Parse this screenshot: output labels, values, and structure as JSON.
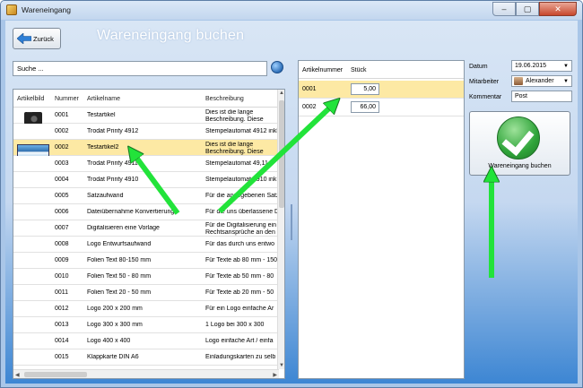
{
  "window": {
    "title": "Wareneingang",
    "controls": {
      "minimize": "–",
      "maximize": "▢",
      "close": "✕"
    }
  },
  "header": {
    "back_label": "Zurück",
    "page_title": "Wareneingang buchen"
  },
  "search": {
    "value": "Suche ..."
  },
  "articles_table": {
    "columns": [
      "Artikelbild",
      "Nummer",
      "Artikelname",
      "Beschreibung"
    ],
    "rows": [
      {
        "nummer": "0001",
        "name": "Testartikel",
        "desc": "Dies ist die lange Beschreibung. Diese können Sie formatieren",
        "image": "camera"
      },
      {
        "nummer": "0002",
        "name": "Trodat Printy 4912",
        "desc": "Stempelautomat 4912 inkl."
      },
      {
        "nummer": "0002",
        "name": "Testartikel2",
        "desc": "Dies ist die lange Beschreibung. Diese können Sie formatieren",
        "image": "landscape",
        "selected": true
      },
      {
        "nummer": "0003",
        "name": "Trodat Printy 4911",
        "desc": "Stempelautomat 49,11"
      },
      {
        "nummer": "0004",
        "name": "Trodat Printy 4910",
        "desc": "Stempelautomat 4910 ink"
      },
      {
        "nummer": "0005",
        "name": "Satzaufwand",
        "desc": "Für die angegebenen Satz"
      },
      {
        "nummer": "0006",
        "name": "Dateiübernahme Konvertierung",
        "desc": "Für die uns überlassene D"
      },
      {
        "nummer": "0007",
        "name": "Digitalisieren eine Vorlage",
        "desc": "Für die Digitalisierung ein Rechtsansprüche an den"
      },
      {
        "nummer": "0008",
        "name": "Logo Entwurfsaufwand",
        "desc": "Für das durch uns entwo"
      },
      {
        "nummer": "0009",
        "name": "Folien Text 80-150 mm",
        "desc": "Für Texte ab 80 mm - 150"
      },
      {
        "nummer": "0010",
        "name": "Folien Text 50 - 80 mm",
        "desc": "Für Texte ab 50 mm - 80"
      },
      {
        "nummer": "0011",
        "name": "Folien Text 20 - 50 mm",
        "desc": "Für Texte ab 20 mm - 50"
      },
      {
        "nummer": "0012",
        "name": "Logo 200 x 200 mm",
        "desc": "Für ein Logo einfache Ar"
      },
      {
        "nummer": "0013",
        "name": "Logo 300 x 300 mm",
        "desc": "1 Logo bei 300 x 300"
      },
      {
        "nummer": "0014",
        "name": "Logo 400 x 400",
        "desc": "Logo einfache Art / einfa"
      },
      {
        "nummer": "0015",
        "name": "Klappkarte DIN A6",
        "desc": "Einladungskarten zu selb"
      }
    ]
  },
  "booking_table": {
    "columns": [
      "Artikelnummer",
      "Stück"
    ],
    "rows": [
      {
        "artikelnummer": "0001",
        "stueck": "5,00",
        "selected": true
      },
      {
        "artikelnummer": "0002",
        "stueck": "66,00"
      }
    ]
  },
  "form": {
    "datum_label": "Datum",
    "datum_value": "19.06.2015",
    "mitarbeiter_label": "Mitarbeiter",
    "mitarbeiter_value": "Alexander",
    "kommentar_label": "Kommentar",
    "kommentar_value": "Post"
  },
  "book_button": {
    "label": "Wareneingang buchen",
    "icon": "checkmark-icon"
  },
  "colors": {
    "selection": "#fde9a4",
    "annotation_arrow": "#22e33a",
    "title_text": "#ffffff"
  }
}
